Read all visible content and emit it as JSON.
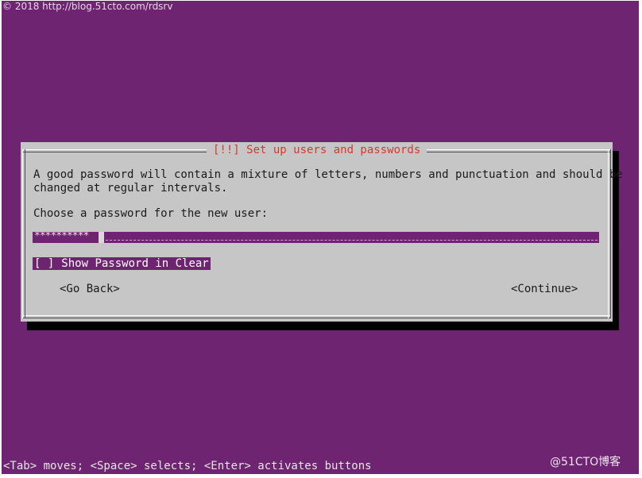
{
  "watermark": "© 2018 http://blog.51cto.com/rdsrv",
  "dialog": {
    "title": "[!!] Set up users and passwords",
    "description_line1": "A good password will contain a mixture of letters, numbers and punctuation and should be",
    "description_line2": "changed at regular intervals.",
    "prompt": "Choose a password for the new user:",
    "password_value": "**********",
    "show_password_checkbox": "[ ]",
    "show_password_label": "Show Password in Clear",
    "go_back_label": "<Go Back>",
    "continue_label": "<Continue>"
  },
  "footer": {
    "hint": "<Tab> moves; <Space> selects; <Enter> activates buttons",
    "brand": "@51CTO博客"
  },
  "colors": {
    "background": "#6f2471",
    "dialog": "#c6c6c6",
    "title": "#d33a2c"
  }
}
